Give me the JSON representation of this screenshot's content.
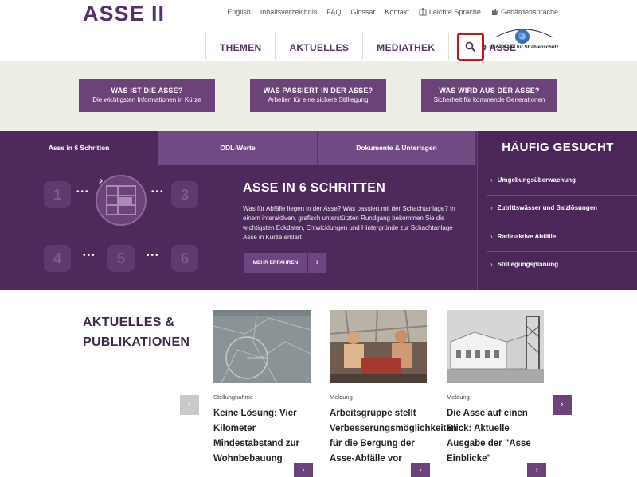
{
  "header": {
    "logo": "ASSE II",
    "utility": [
      {
        "label": "English",
        "icon": ""
      },
      {
        "label": "Inhaltsverzeichnis",
        "icon": ""
      },
      {
        "label": "FAQ",
        "icon": ""
      },
      {
        "label": "Glossar",
        "icon": ""
      },
      {
        "label": "Kontakt",
        "icon": ""
      },
      {
        "label": "Leichte Sprache",
        "icon": "easy-language-icon"
      },
      {
        "label": "Gebärdensprache",
        "icon": "sign-language-icon"
      }
    ],
    "nav": [
      "THEMEN",
      "AKTUELLES",
      "MEDIATHEK",
      "INFO ASSE"
    ],
    "agency": "Bundesamt für Strahlenschutz"
  },
  "tiles": [
    {
      "title": "WAS IST DIE ASSE?",
      "subtitle": "Die wichtigsten Informationen in Kürze"
    },
    {
      "title": "WAS PASSIERT IN DER ASSE?",
      "subtitle": "Arbeiten für eine sichere Stilllegung"
    },
    {
      "title": "WAS WIRD AUS DER ASSE?",
      "subtitle": "Sicherheit für kommende Generationen"
    }
  ],
  "tabs": [
    "Asse in 6 Schritten",
    "ODL-Werte",
    "Dokumente & Unterlagen"
  ],
  "steps": [
    "1",
    "2",
    "3",
    "4",
    "5",
    "6"
  ],
  "hero": {
    "title": "ASSE IN 6 SCHRITTEN",
    "text": "Was für Abfälle liegen in der Asse? Was passiert mit der Schachtanlage? In einem interaktiven, grafisch unterstützten Rundgang bekommen Sie die wichtigsten Eckdaten, Entwicklungen und Hintergründe zur Schachtanlage Asse in Kürze erklärt",
    "button": "MEHR ERFAHREN"
  },
  "faq": {
    "title": "HÄUFIG GESUCHT",
    "items": [
      "Umgebungsüberwachung",
      "Zutrittswässer und Salzlösungen",
      "Radioaktive Abfälle",
      "Stilllegungsplanung"
    ]
  },
  "news": {
    "heading_line1": "AKTUELLES &",
    "heading_line2": "PUBLIKATIONEN",
    "cards": [
      {
        "kind": "Stellungnahme",
        "title": "Keine Lösung: Vier Kilometer Mindestabstand zur Wohnbebauung",
        "image": "map-image"
      },
      {
        "kind": "Meldung",
        "title": "Arbeitsgruppe stellt Verbesserungsmöglichkeiten für die Bergung der Asse-Abfälle vor",
        "image": "workers-image"
      },
      {
        "kind": "Meldung",
        "title": "Die Asse auf einen Blick: Aktuelle Ausgabe der \"Asse Einblicke\"",
        "image": "building-image"
      }
    ]
  },
  "colors": {
    "brand": "#553366",
    "tile": "#6b4379",
    "band": "#eeeee7",
    "purple": "#4e2a5c",
    "search_highlight": "#d0131b"
  }
}
